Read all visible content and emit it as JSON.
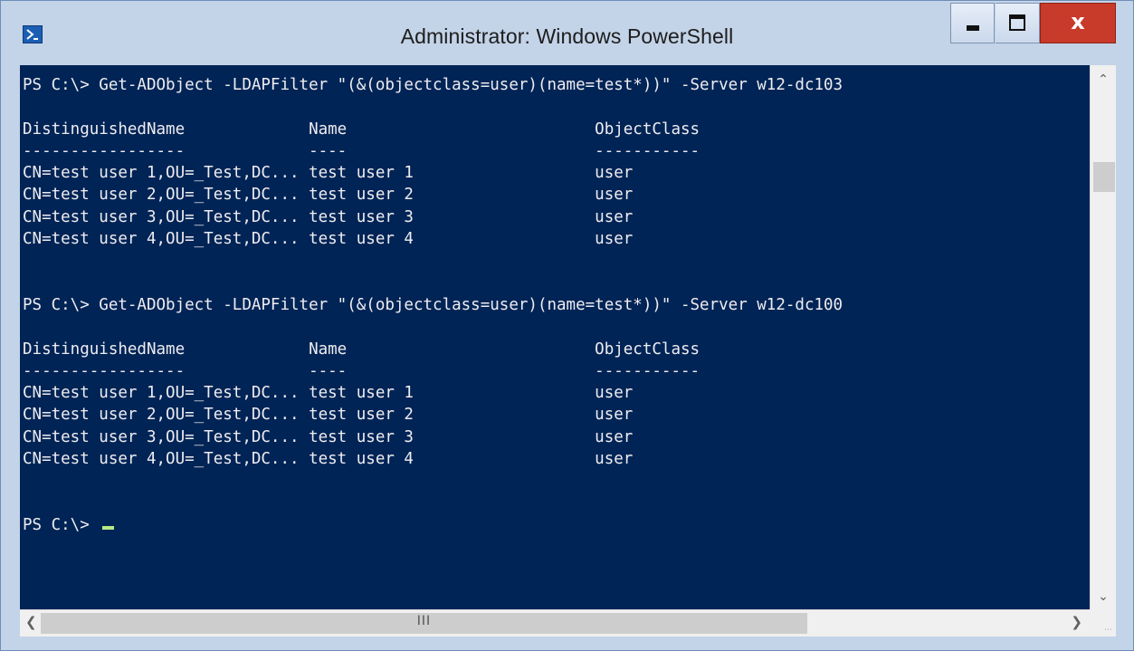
{
  "window": {
    "title": "Administrator: Windows PowerShell",
    "icon": "powershell-icon",
    "controls": {
      "minimize": "minimize-icon",
      "maximize": "maximize-icon",
      "close_label": "x"
    }
  },
  "colors": {
    "console_bg": "#012456",
    "console_text": "#eeedf0",
    "cursor": "#b8e986",
    "titlebar": "#c3d3e8",
    "close_button": "#c83a2a"
  },
  "console": {
    "lines": [
      "PS C:\\> Get-ADObject -LDAPFilter \"(&(objectclass=user)(name=test*))\" -Server w12-dc103",
      "",
      "DistinguishedName             Name                          ObjectClass",
      "-----------------             ----                          -----------",
      "CN=test user 1,OU=_Test,DC... test user 1                   user",
      "CN=test user 2,OU=_Test,DC... test user 2                   user",
      "CN=test user 3,OU=_Test,DC... test user 3                   user",
      "CN=test user 4,OU=_Test,DC... test user 4                   user",
      "",
      "",
      "PS C:\\> Get-ADObject -LDAPFilter \"(&(objectclass=user)(name=test*))\" -Server w12-dc100",
      "",
      "DistinguishedName             Name                          ObjectClass",
      "-----------------             ----                          -----------",
      "CN=test user 1,OU=_Test,DC... test user 1                   user",
      "CN=test user 2,OU=_Test,DC... test user 2                   user",
      "CN=test user 3,OU=_Test,DC... test user 3                   user",
      "CN=test user 4,OU=_Test,DC... test user 4                   user",
      "",
      "",
      "PS C:\\> "
    ]
  },
  "scrollbars": {
    "vertical": {
      "up": "chevron-up-icon",
      "down": "chevron-down-icon"
    },
    "horizontal": {
      "left": "chevron-left-icon",
      "right": "chevron-right-icon",
      "grip": "III"
    }
  }
}
